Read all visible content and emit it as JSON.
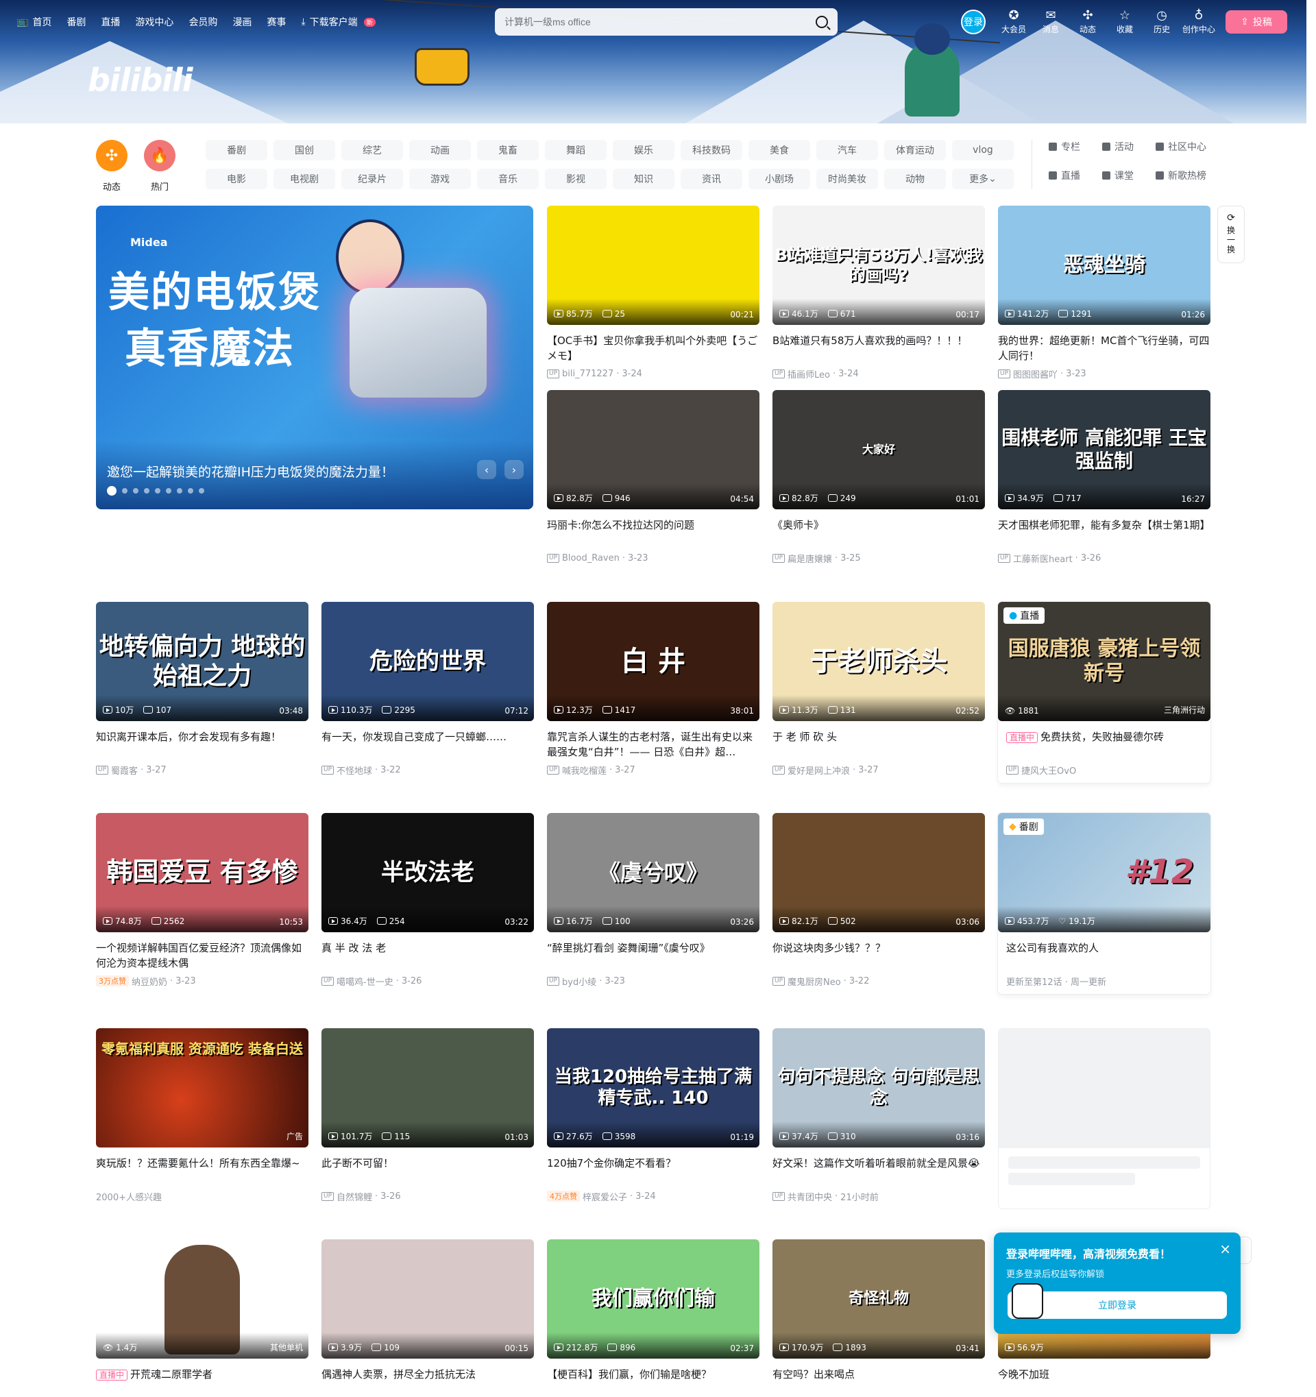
{
  "header": {
    "nav": [
      {
        "label": "首页",
        "icon": "tv-icon"
      },
      {
        "label": "番剧"
      },
      {
        "label": "直播"
      },
      {
        "label": "游戏中心"
      },
      {
        "label": "会员购"
      },
      {
        "label": "漫画"
      },
      {
        "label": "赛事"
      },
      {
        "label": "下载客户端",
        "icon": "download-icon",
        "badge": "新"
      }
    ],
    "search_placeholder": "计算机一级ms office",
    "login": "登录",
    "right_items": [
      {
        "label": "大会员",
        "icon": "vip-icon"
      },
      {
        "label": "消息",
        "icon": "message-icon"
      },
      {
        "label": "动态",
        "icon": "dynamic-icon"
      },
      {
        "label": "收藏",
        "icon": "star-icon"
      },
      {
        "label": "历史",
        "icon": "clock-icon"
      },
      {
        "label": "创作中心",
        "icon": "bulb-icon"
      }
    ],
    "upload": "投稿"
  },
  "channels": {
    "round": [
      {
        "label": "动态",
        "color": "#ff9212"
      },
      {
        "label": "热门",
        "color": "#f07775"
      }
    ],
    "row1": [
      "番剧",
      "国创",
      "综艺",
      "动画",
      "鬼畜",
      "舞蹈",
      "娱乐",
      "科技数码",
      "美食",
      "汽车",
      "体育运动",
      "vlog"
    ],
    "row2": [
      "电影",
      "电视剧",
      "纪录片",
      "游戏",
      "音乐",
      "影视",
      "知识",
      "资讯",
      "小剧场",
      "时尚美妆",
      "动物",
      "更多"
    ],
    "side": [
      "专栏",
      "活动",
      "社区中心",
      "直播",
      "课堂",
      "新歌热榜"
    ]
  },
  "carousel": {
    "brand": "Midea",
    "headline1": "美的电饭煲",
    "headline2": "真香魔法",
    "caption": "邀您一起解锁美的花瓣IH压力电饭煲的魔法力量！",
    "prev": "‹",
    "next": "›",
    "slide_count": 9
  },
  "refresh": {
    "label1": "换",
    "label2": "一",
    "label3": "换"
  },
  "videos": [
    {
      "title": "【OC手书】宝贝你拿我手机叫个外卖吧【うごメモ】",
      "views": "85.7万",
      "danmaku": "25",
      "duration": "00:21",
      "author": "bili_771227",
      "date": "3-24",
      "bg": "#f6e100",
      "overlay": ""
    },
    {
      "title": "B站难道只有58万人喜欢我的画吗？！！！",
      "views": "46.1万",
      "danmaku": "671",
      "duration": "00:17",
      "author": "插画师Leo",
      "date": "3-24",
      "bg": "#f3f3f3",
      "overlay": "B站难道只有58万人!喜欢我的画吗?"
    },
    {
      "title": "我的世界：超绝更新！MC首个飞行坐骑，可四人同行！",
      "views": "141.2万",
      "danmaku": "1291",
      "duration": "01:26",
      "author": "图图图酱吖",
      "date": "3-23",
      "bg": "#8ec5e8",
      "overlay": "恶魂坐骑"
    },
    {
      "title": "玛丽卡:你怎么不找拉达冈的问题",
      "views": "82.8万",
      "danmaku": "946",
      "duration": "04:54",
      "author": "Blood_Raven",
      "date": "3-23",
      "bg": "#4a4540",
      "overlay": ""
    },
    {
      "title": "《奥师卡》",
      "views": "82.8万",
      "danmaku": "249",
      "duration": "01:01",
      "author": "扁是唐嬢嬢",
      "date": "3-25",
      "bg": "#3b3a38",
      "overlay": "大家好"
    },
    {
      "title": "天才围棋老师犯罪，能有多复杂【棋士第1期】",
      "views": "34.9万",
      "danmaku": "717",
      "duration": "16:27",
      "author": "工藤新医heart",
      "date": "3-26",
      "bg": "#2e3840",
      "overlay": "围棋老师 高能犯罪 王宝强监制"
    },
    {
      "title": "知识离开课本后，你才会发现有多有趣！",
      "views": "10万",
      "danmaku": "107",
      "duration": "03:48",
      "author": "蜀霞客",
      "date": "3-27",
      "bg": "#3a5b7d",
      "overlay": "地转偏向力 地球的始祖之力"
    },
    {
      "title": "有一天，你发现自己变成了一只蟑螂……",
      "views": "110.3万",
      "danmaku": "2295",
      "duration": "07:12",
      "author": "不怪地球",
      "date": "3-22",
      "bg": "#2d4a7a",
      "overlay": "危险的世界"
    },
    {
      "title": "靠咒言杀人谋生的古老村落，诞生出有史以来最强女鬼“白井”！—— 日恐《白井》超…",
      "views": "12.3万",
      "danmaku": "1417",
      "duration": "38:01",
      "author": "喊我吃榴莲",
      "date": "3-27",
      "bg": "#3a1c10",
      "overlay": "白 井"
    },
    {
      "title": "于 老 师 砍 头",
      "views": "11.3万",
      "danmaku": "131",
      "duration": "02:52",
      "author": "爱好是网上冲浪",
      "date": "3-27",
      "bg": "#f3e2b6",
      "overlay": "于老师杀头"
    },
    {
      "title": "真 半 改 法 老",
      "views": "36.4万",
      "danmaku": "254",
      "duration": "03:22",
      "author": "噶噶鸡-世一史",
      "date": "3-26",
      "bg": "#101010",
      "overlay": "半改法老"
    },
    {
      "title": "“醉里挑灯看剑 姿舞阑珊”《虞兮叹》",
      "views": "16.7万",
      "danmaku": "100",
      "duration": "03:26",
      "author": "byd小绫",
      "date": "3-23",
      "bg": "#8a8a8a",
      "overlay": "《虞兮叹》"
    },
    {
      "title": "你说这块肉多少钱？？？",
      "views": "82.1万",
      "danmaku": "502",
      "duration": "03:06",
      "author": "魔鬼厨房Neo",
      "date": "3-22",
      "bg": "#6a4a2a",
      "overlay": ""
    },
    {
      "title": "一个视频详解韩国百亿爱豆经济？顶流偶像如何沦为资本提线木偶",
      "views": "74.8万",
      "danmaku": "2562",
      "duration": "10:53",
      "author": "纳豆奶奶",
      "date": "3-23",
      "bg": "#c75a63",
      "overlay": "韩国爱豆 有多惨",
      "hot": "3万点赞"
    },
    {
      "title": "此子断不可留！",
      "views": "101.7万",
      "danmaku": "115",
      "duration": "01:03",
      "author": "自然锦鲤",
      "date": "3-26",
      "bg": "#4d5a4a",
      "overlay": ""
    },
    {
      "title": "120抽7个金你确定不看看？",
      "views": "27.6万",
      "danmaku": "3598",
      "duration": "01:19",
      "author": "梓宸爱公子",
      "date": "3-24",
      "bg": "#2b3d66",
      "overlay": "当我120抽给号主抽了满精专武.. 140",
      "hot": "4万点赞"
    },
    {
      "title": "好文采！这篇作文听着听着眼前就全是风景😭",
      "views": "37.4万",
      "danmaku": "310",
      "duration": "03:16",
      "author": "共青团中央",
      "date": "21小时前",
      "bg": "#b6c7d3",
      "overlay": "句句不提思念 句句都是思念"
    },
    {
      "title": "偶遇神人卖票，拼尽全力抵抗无法",
      "views": "3.9万",
      "danmaku": "109",
      "duration": "00:15",
      "bg": "#d8c8c8",
      "overlay": ""
    },
    {
      "title": "【梗百科】我们赢，你们输是啥梗？",
      "views": "212.8万",
      "danmaku": "896",
      "duration": "02:37",
      "bg": "#7fd07f",
      "overlay": "我们赢你们输"
    },
    {
      "title": "有空吗？出来喝点",
      "views": "170.9万",
      "danmaku": "1893",
      "duration": "03:41",
      "bg": "#8a7a5a",
      "overlay": "奇怪礼物"
    }
  ],
  "live_cards": [
    {
      "title": "免费扶贫，失败抽曼德尔砖",
      "viewers": "1881",
      "area": "三角洲行动",
      "author": "捷风大王OvO",
      "tag": "直播",
      "live_label": "直播中",
      "bg": "#3d3a33",
      "overlay": "国服唐狼 豪猪上号领新号"
    },
    {
      "title": "开荒魂二原罪学者",
      "viewers": "1.4万",
      "area": "其他单机",
      "live_label": "直播中",
      "bg": "#ffffff"
    }
  ],
  "bangumi": {
    "title": "这公司有我喜欢的人",
    "views": "453.7万",
    "likes": "19.1万",
    "update": "更新至第12话 · 周一更新",
    "tag": "番剧",
    "bg": "#6fa0c6",
    "overlay": "#12"
  },
  "ad": {
    "title": "爽玩版！？还需要氪什么！所有东西全靠爆~",
    "tag": "广告",
    "meta": "2000+人感兴趣",
    "bg": "#5a1a10",
    "overlay": "零氪福利真服 资源通吃 装备白送"
  },
  "last_card": {
    "title": "今晚不加班",
    "views": "56.9万",
    "bg": "#ffd84a"
  },
  "login_popup": {
    "title": "登录哔哩哔哩，高清视频免费看！",
    "sub": "更多登录后权益等你解锁",
    "button": "立即登录",
    "close": "×"
  }
}
